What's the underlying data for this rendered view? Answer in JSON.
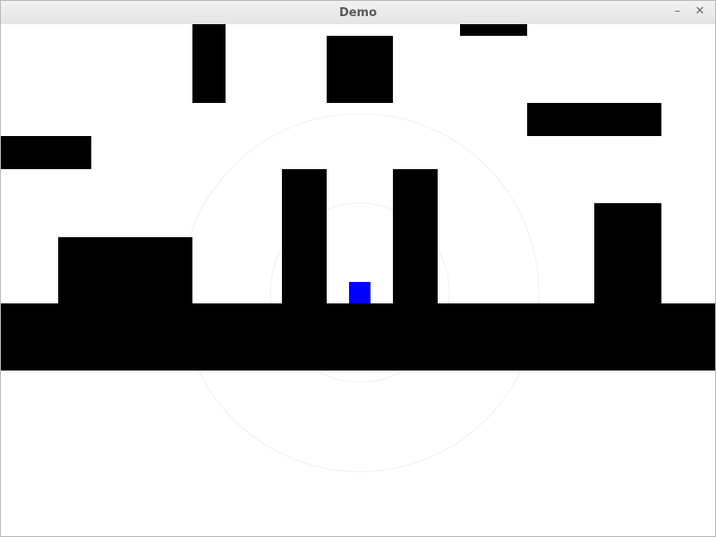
{
  "window": {
    "title": "Demo",
    "minimize_glyph": "–",
    "close_glyph": "✕"
  },
  "game": {
    "background_color": "#ffffff",
    "wall_color": "#000000",
    "player_color": "#0000ff",
    "range_ring_color": "#e6f6e6"
  }
}
